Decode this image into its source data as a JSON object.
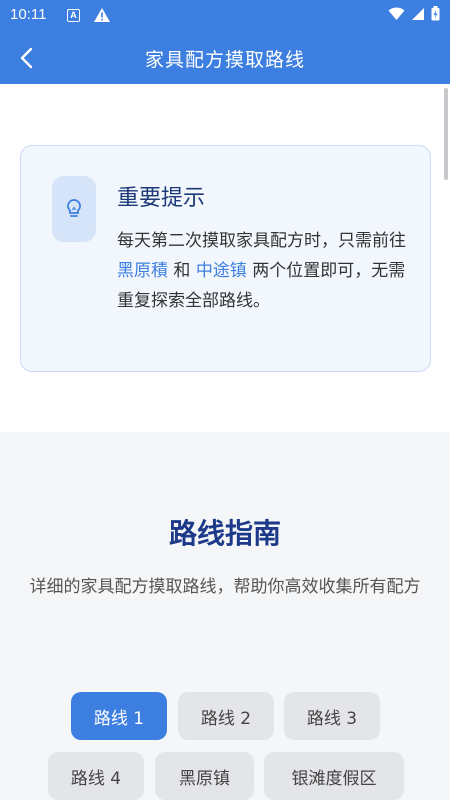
{
  "status_bar": {
    "time": "10:11",
    "icon_a": "A",
    "icons": [
      "wifi-icon",
      "signal-icon",
      "battery-icon"
    ]
  },
  "app_bar": {
    "title": "家具配方摸取路线",
    "back_icon": "chevron-left-icon",
    "color": "#3d7fe0"
  },
  "tip": {
    "icon": "lightbulb-icon",
    "title": "重要提示",
    "text_before": "每天第二次摸取家具配方时，只需前往 ",
    "place_1": "黑原積",
    "text_middle": " 和 ",
    "place_2": "中途镇",
    "text_after": " 两个位置即可，无需重复探索全部路线。"
  },
  "guide": {
    "title": "路线指南",
    "subtitle": "详细的家具配方摸取路线，帮助你高效收集所有配方",
    "chips": [
      {
        "label": "路线 1",
        "active": true
      },
      {
        "label": "路线 2",
        "active": false
      },
      {
        "label": "路线 3",
        "active": false
      },
      {
        "label": "路线 4",
        "active": false
      },
      {
        "label": "黑原镇",
        "active": false
      },
      {
        "label": "银滩度假区",
        "active": false
      }
    ]
  }
}
